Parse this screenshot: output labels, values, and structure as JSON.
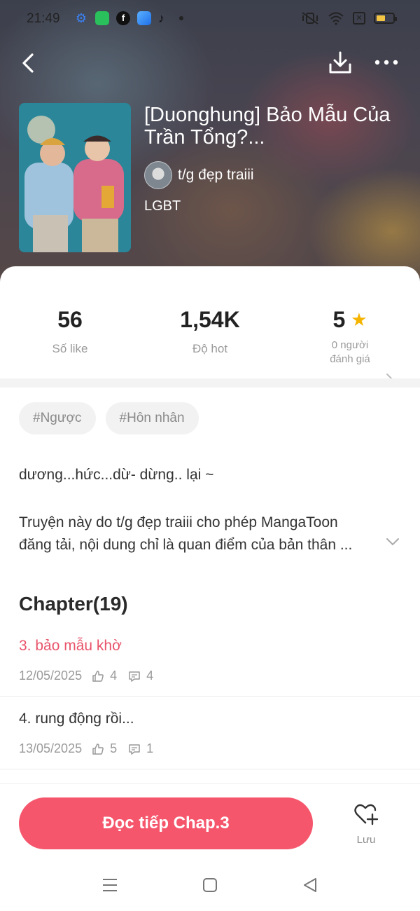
{
  "status_bar": {
    "time": "21:49"
  },
  "header": {
    "title": "[Duonghung] Bảo Mẫu Của Trần Tổng?...",
    "author": "t/g đẹp traiii",
    "genre": "LGBT"
  },
  "stats": {
    "likes": {
      "value": "56",
      "label": "Số like"
    },
    "hot": {
      "value": "1,54K",
      "label": "Độ hot"
    },
    "rating": {
      "value": "5",
      "label_line1": "0 người",
      "label_line2": "đánh giá"
    }
  },
  "tags": [
    "#Ngược",
    "#Hôn nhân"
  ],
  "description": {
    "line1": "dương...hức...dừ- dừng.. lại ~",
    "line2": "Truyện này do t/g đẹp traiii cho phép MangaToon",
    "line3": "đăng tải, nội dung chỉ là quan điểm của bản thân ..."
  },
  "chapters": {
    "heading": "Chapter(19)",
    "items": [
      {
        "name": "3. bảo mẫu khờ",
        "date": "12/05/2025",
        "likes": "4",
        "comments": "4",
        "highlight": true
      },
      {
        "name": "4. rung động rồi...",
        "date": "13/05/2025",
        "likes": "5",
        "comments": "1",
        "highlight": false
      }
    ]
  },
  "bottom": {
    "read_label": "Đọc tiếp Chap.3",
    "save_label": "Lưu"
  },
  "colors": {
    "accent": "#f5566c",
    "star": "#f5b400",
    "highlight_text": "#e8546b"
  }
}
